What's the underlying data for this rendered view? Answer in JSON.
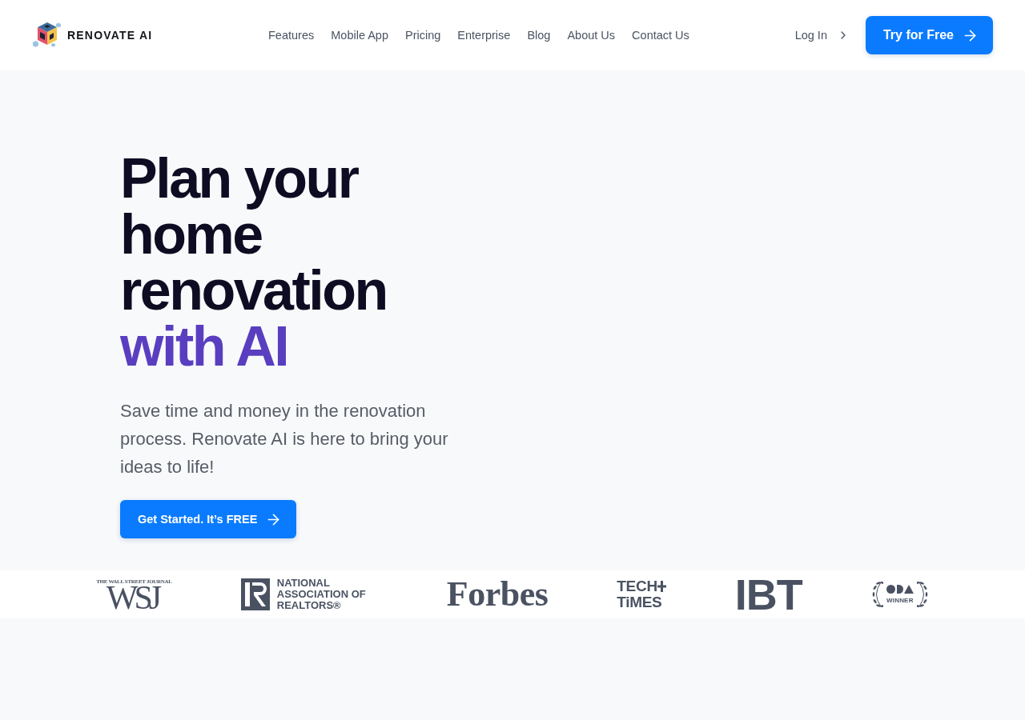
{
  "header": {
    "brand": "RENOVATE AI",
    "nav": [
      "Features",
      "Mobile App",
      "Pricing",
      "Enterprise",
      "Blog",
      "About Us",
      "Contact Us"
    ],
    "login": "Log In",
    "cta": "Try for Free"
  },
  "hero": {
    "title": "Plan your home renovation",
    "title_highlight": "with AI",
    "subtitle": "Save time and money in the renovation process. Renovate AI is here to bring your ideas to life!",
    "cta": "Get Started. It’s FREE"
  },
  "press_logos": [
    {
      "kind": "wsj",
      "kicker": "THE WALL STREET JOURNAL",
      "name": "WSJ"
    },
    {
      "kind": "realtors",
      "name": "NATIONAL ASSOCIATION OF REALTORS®"
    },
    {
      "kind": "forbes",
      "name": "Forbes"
    },
    {
      "kind": "techtimes",
      "lines": [
        "TECH",
        "TiMES"
      ]
    },
    {
      "kind": "ibt",
      "name": "IBT"
    },
    {
      "kind": "award",
      "name": "WINNER"
    }
  ]
}
